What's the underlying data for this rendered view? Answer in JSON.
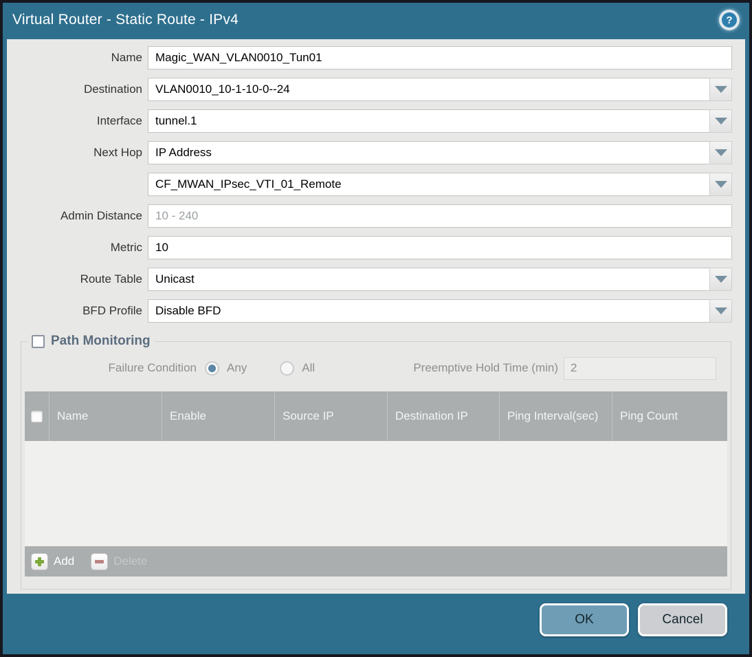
{
  "title_bar": {
    "title": "Virtual Router - Static Route - IPv4",
    "help_icon_glyph": "?"
  },
  "form": {
    "fields": [
      {
        "label": "Name",
        "value": "Magic_WAN_VLAN0010_Tun01",
        "type": "text"
      },
      {
        "label": "Destination",
        "value": "VLAN0010_10-1-10-0--24",
        "type": "dropdown"
      },
      {
        "label": "Interface",
        "value": "tunnel.1",
        "type": "dropdown"
      },
      {
        "label": "Next Hop",
        "value": "IP Address",
        "type": "dropdown"
      },
      {
        "label": "",
        "value": "CF_MWAN_IPsec_VTI_01_Remote",
        "type": "dropdown"
      },
      {
        "label": "Admin Distance",
        "value": "",
        "placeholder": "10 - 240",
        "type": "text"
      },
      {
        "label": "Metric",
        "value": "10",
        "type": "text"
      },
      {
        "label": "Route Table",
        "value": "Unicast",
        "type": "dropdown"
      },
      {
        "label": "BFD Profile",
        "value": "Disable BFD",
        "type": "dropdown"
      }
    ]
  },
  "path_monitoring": {
    "legend": "Path Monitoring",
    "checkbox_checked": false,
    "failure_condition": {
      "label": "Failure Condition",
      "options": [
        "Any",
        "All"
      ],
      "selected": "Any"
    },
    "preemptive_hold_time": {
      "label": "Preemptive Hold Time (min)",
      "value": "2"
    },
    "table": {
      "columns": [
        "Name",
        "Enable",
        "Source IP",
        "Destination IP",
        "Ping Interval(sec)",
        "Ping Count"
      ],
      "rows": []
    },
    "toolbar": {
      "add_label": "Add",
      "delete_label": "Delete"
    }
  },
  "footer": {
    "ok_label": "OK",
    "cancel_label": "Cancel"
  },
  "colors": {
    "titlebar_teal": "#2e6f8e",
    "panel_gray": "#e8e8e7",
    "table_header_gray": "#abaeae",
    "ok_button": "#6f9db5",
    "cancel_button": "#ccced1",
    "add_icon_green": "#7daa3a",
    "delete_icon_red": "#bc8181",
    "radio_selected": "#5b87a5",
    "dropdown_arrow": "#76909f"
  }
}
